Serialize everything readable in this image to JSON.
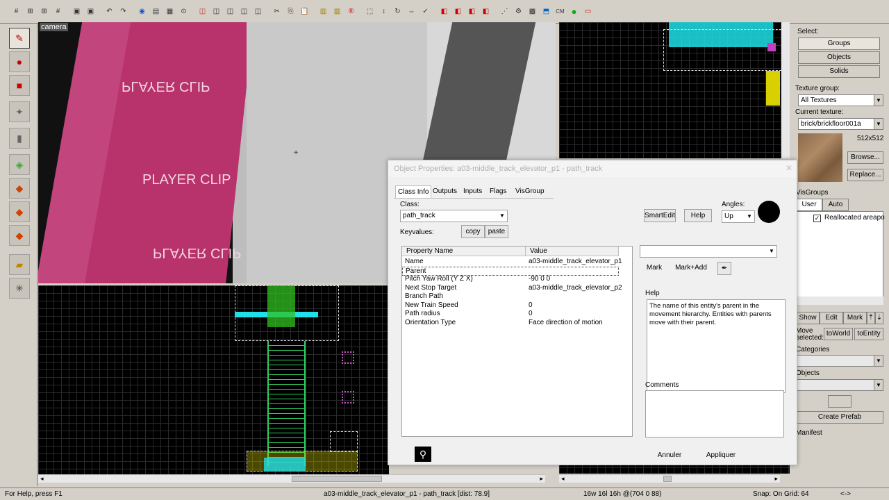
{
  "toolbar": {
    "buttons": [
      "grid-toggle",
      "grid-smaller",
      "grid-larger",
      "grid-3d",
      "group",
      "ungroup",
      "undo",
      "redo",
      "carve",
      "hollow",
      "texture-lock",
      "ignore-groups",
      "hide",
      "show",
      "cut",
      "copy",
      "paste",
      "hammer",
      "texture-app",
      "entity-report",
      "bounding-box",
      "move",
      "rotate",
      "flip",
      "check",
      "run-map",
      "cm",
      "compile",
      "prefab"
    ],
    "cm_label": "CM"
  },
  "viewports": {
    "camera_label": "camera",
    "texture_text": [
      "PLAYER CLIP",
      "PLAYER CLIP",
      "PLAYER CLIP",
      "PLAYER CLIP"
    ]
  },
  "right_panel": {
    "select_label": "Select:",
    "groups": "Groups",
    "objects": "Objects",
    "solids": "Solids",
    "texture_group_label": "Texture group:",
    "texture_group_value": "All Textures",
    "current_texture_label": "Current texture:",
    "current_texture_value": "brick/brickfloor001a",
    "texture_size": "512x512",
    "browse": "Browse...",
    "replace": "Replace...",
    "visgroups_label": "VisGroups",
    "user_tab": "User",
    "auto_tab": "Auto",
    "visgroup_item": "Reallocated areapo",
    "show": "Show",
    "edit": "Edit",
    "mark": "Mark",
    "move_selected": "Move selected:",
    "to_world": "toWorld",
    "to_entity": "toEntity",
    "categories": "Categories",
    "objects_label": "Objects",
    "create_prefab": "Create Prefab",
    "manifest": "Manifest"
  },
  "dialog": {
    "title": "Object Properties: a03-middle_track_elevator_p1 - path_track",
    "tabs": [
      "Class Info",
      "Outputs",
      "Inputs",
      "Flags",
      "VisGroup"
    ],
    "class_label": "Class:",
    "class_value": "path_track",
    "keyvalues_label": "Keyvalues:",
    "copy": "copy",
    "paste": "paste",
    "smartedit": "SmartEdit",
    "help_button": "Help",
    "angles_label": "Angles:",
    "angles_value": "Up",
    "mark": "Mark",
    "mark_add": "Mark+Add",
    "col_property": "Property Name",
    "col_value": "Value",
    "rows": [
      {
        "k": "Name",
        "v": "a03-middle_track_elevator_p1"
      },
      {
        "k": "Parent",
        "v": ""
      },
      {
        "k": "Pitch Yaw Roll (Y Z X)",
        "v": "-90 0 0"
      },
      {
        "k": "Next Stop Target",
        "v": "a03-middle_track_elevator_p2"
      },
      {
        "k": "Branch Path",
        "v": ""
      },
      {
        "k": "New Train Speed",
        "v": "0"
      },
      {
        "k": "Path radius",
        "v": "0"
      },
      {
        "k": "Orientation Type",
        "v": "Face direction of motion"
      }
    ],
    "help_label": "Help",
    "help_text": "The name of this entity's parent in the movement hierarchy. Entities with parents move with their parent.",
    "comments_label": "Comments",
    "cancel": "Annuler",
    "apply": "Appliquer"
  },
  "status": {
    "help": "For Help, press F1",
    "selection": "a03-middle_track_elevator_p1 - path_track  [dist: 78.9]",
    "dims": "16w 16l 16h @(704 0 88)",
    "snap": "Snap: On Grid: 64",
    "arrows": "<->"
  }
}
